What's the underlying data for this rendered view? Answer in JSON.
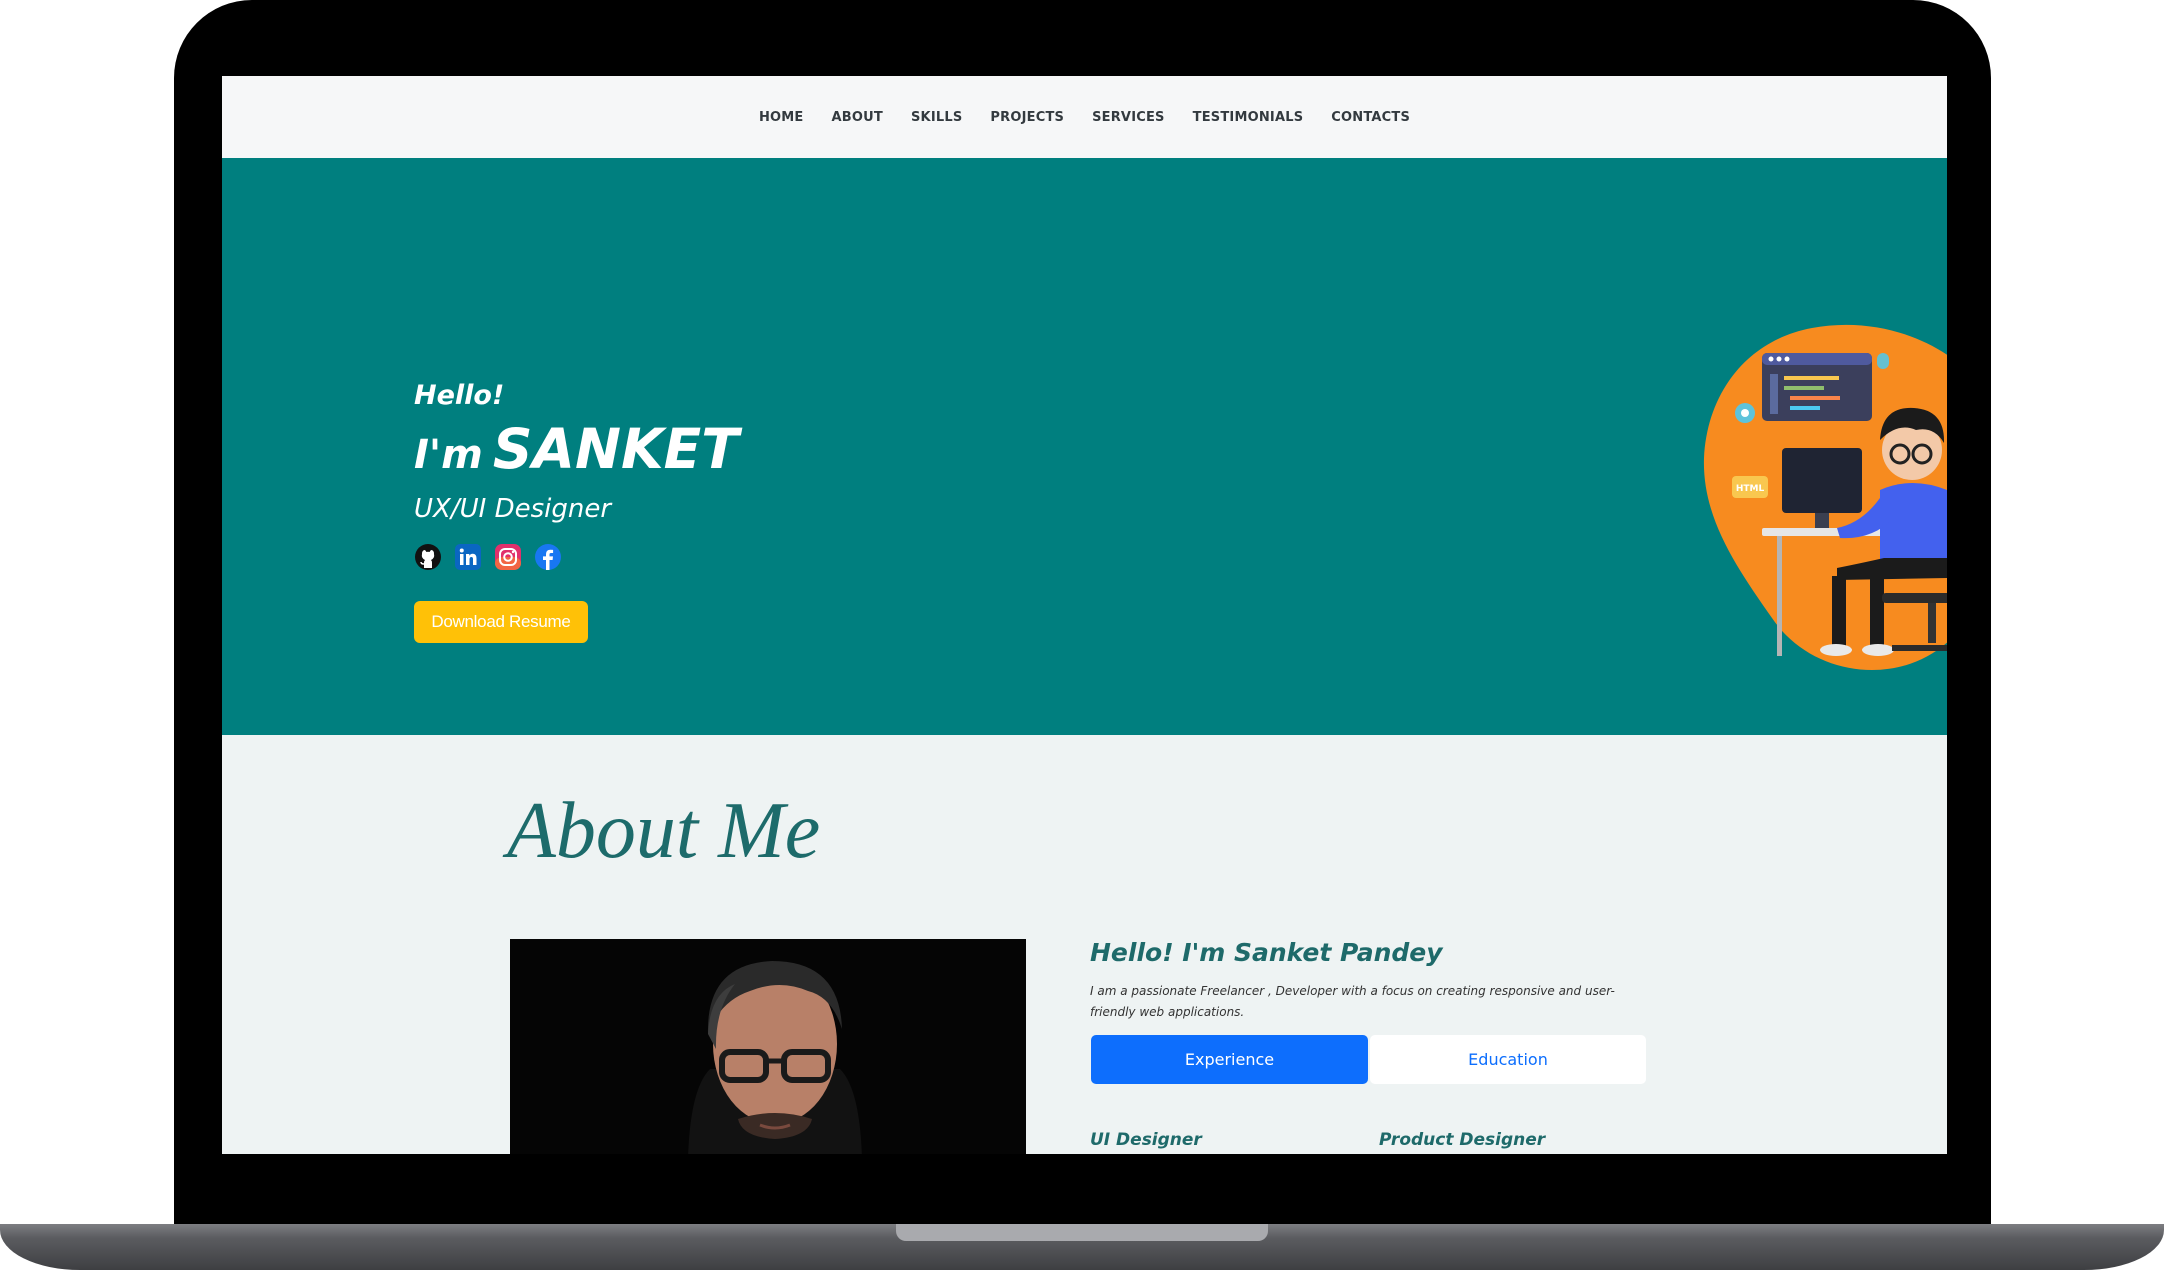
{
  "nav": {
    "items": [
      "HOME",
      "ABOUT",
      "SKILLS",
      "PROJECTS",
      "SERVICES",
      "TESTIMONIALS",
      "CONTACTS"
    ]
  },
  "hero": {
    "greeting": "Hello!",
    "name_prefix": "I'm",
    "name": "SANKET",
    "role": "UX/UI Designer",
    "social_icons": [
      "github-icon",
      "linkedin-icon",
      "instagram-icon",
      "facebook-icon"
    ],
    "resume_button": "Download Resume",
    "illustration_badges": [
      "HTML"
    ]
  },
  "about": {
    "title": "About Me",
    "heading": "Hello! I'm Sanket Pandey",
    "description": "I am a passionate Freelancer , Developer with a focus on creating responsive and user-friendly web applications.",
    "tabs": {
      "experience": "Experience",
      "education": "Education"
    },
    "jobs": [
      "UI Designer",
      "Product Designer"
    ]
  },
  "colors": {
    "hero_bg": "#007f7f",
    "accent_yellow": "#ffc107",
    "primary_blue": "#0d6efd",
    "heading_teal": "#1e6a6a",
    "blob_orange": "#f78b1f"
  }
}
